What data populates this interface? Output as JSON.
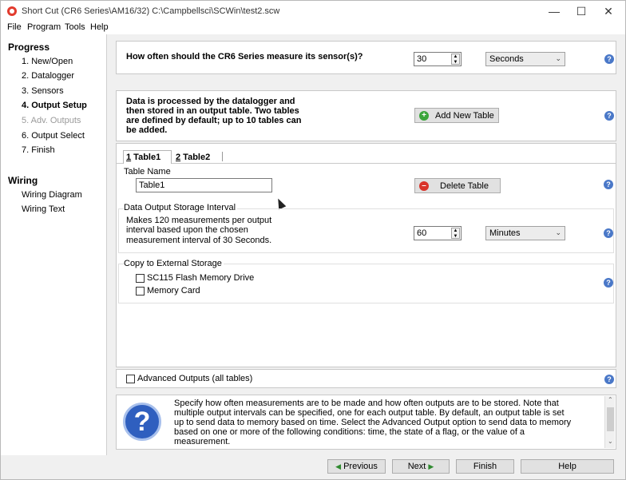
{
  "window": {
    "title": "Short Cut (CR6 Series\\AM16/32) C:\\Campbellsci\\SCWin\\test2.scw",
    "minimize": "—",
    "maximize": "☐",
    "close": "✕"
  },
  "menu": [
    "File",
    "Program",
    "Tools",
    "Help"
  ],
  "nav": {
    "progress_heading": "Progress",
    "steps": [
      {
        "label": "1. New/Open"
      },
      {
        "label": "2. Datalogger"
      },
      {
        "label": "3. Sensors"
      },
      {
        "label": "4. Output Setup",
        "current": true
      },
      {
        "label": "5. Adv. Outputs",
        "disabled": true
      },
      {
        "label": "6. Output Select"
      },
      {
        "label": "7. Finish"
      }
    ],
    "wiring_heading": "Wiring",
    "wiring": [
      "Wiring Diagram",
      "Wiring Text"
    ]
  },
  "measure": {
    "question": "How often should the CR6 Series measure its sensor(s)?",
    "value": "30",
    "unit": "Seconds"
  },
  "tables_info": {
    "text1": "Data is processed by the datalogger and",
    "text2": "then stored in an output table. Two tables",
    "text3": "are defined by default; up to 10 tables can",
    "text4": "be added.",
    "add_button": "Add New Table"
  },
  "tabs": [
    {
      "num": "1",
      "label": " Table1"
    },
    {
      "num": "2",
      "label": " Table2"
    }
  ],
  "table_name": {
    "label": "Table Name",
    "value": "Table1",
    "delete_button": "Delete Table"
  },
  "interval": {
    "label": "Data Output Storage Interval",
    "desc1": "Makes 120 measurements per output",
    "desc2": "interval based upon the chosen",
    "desc3": "measurement interval of 30 Seconds.",
    "value": "60",
    "unit": "Minutes"
  },
  "external": {
    "label": "Copy to External Storage",
    "options": [
      "SC115 Flash Memory Drive",
      "Memory Card"
    ]
  },
  "advanced": {
    "label": "Advanced Outputs (all tables)"
  },
  "help_icon_glyph": "?",
  "help_text": {
    "line1": "Specify how often measurements are to be made and how often outputs are to be stored. Note that",
    "line2": "multiple output intervals can be specified, one for each output table. By default, an output table is set",
    "line3": "up to send data to memory based on time. Select the Advanced Output option to send data to memory",
    "line4": "based on one or more of the following conditions: time, the state of a flag, or the value of a",
    "line5": "measurement."
  },
  "footer": {
    "previous": "Previous",
    "next": "Next",
    "finish": "Finish",
    "help": "Help"
  },
  "colors": {
    "accent": "#4a78c8",
    "add_green": "#3aa53a",
    "delete_red": "#d9342b"
  }
}
